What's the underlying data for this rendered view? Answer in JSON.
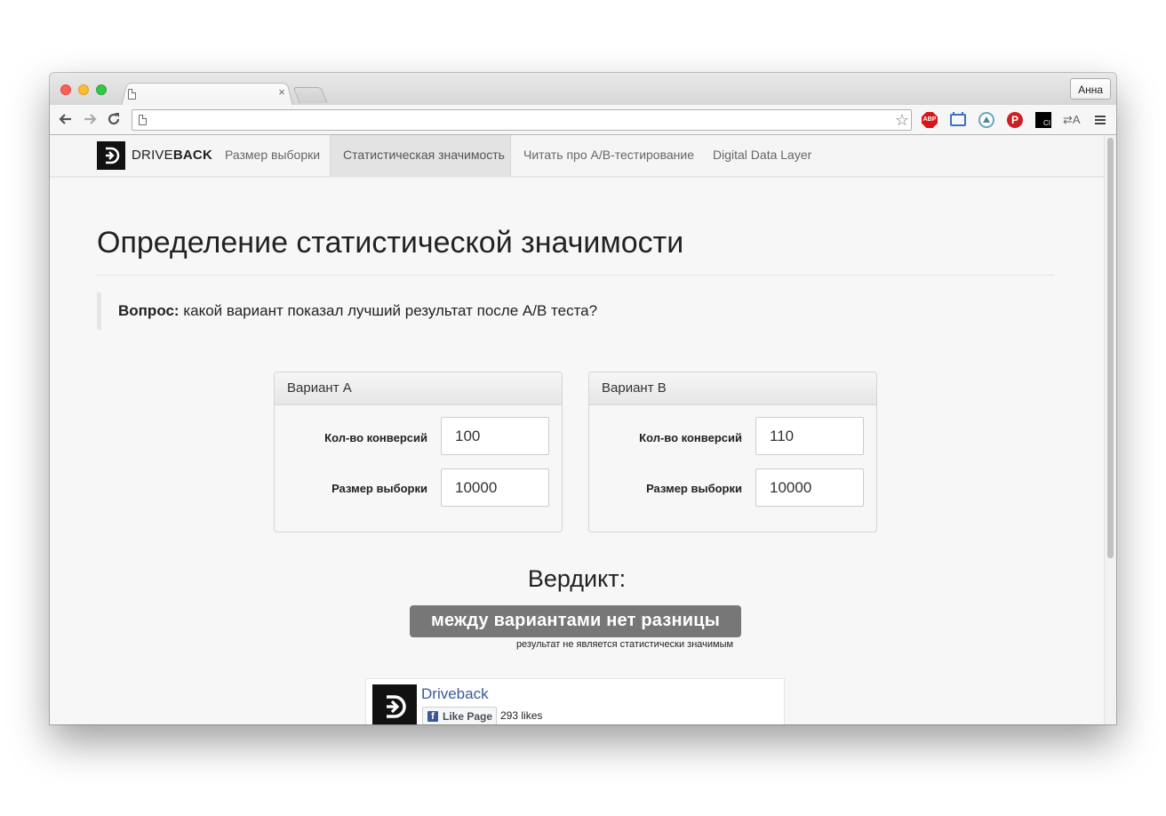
{
  "browser": {
    "tab_close": "×",
    "profile": "Анна",
    "address_value": ""
  },
  "nav": {
    "logo_prefix": "DRIVE",
    "logo_suffix": "BACK",
    "items": [
      {
        "label": "Размер выборки"
      },
      {
        "label": "Статистическая значимость"
      },
      {
        "label": "Читать про A/B-тестирование"
      },
      {
        "label": "Digital Data Layer"
      }
    ]
  },
  "page": {
    "title": "Определение статистической значимости",
    "question_label": "Вопрос:",
    "question_text": " какой вариант показал лучший результат после A/B теста?"
  },
  "variants": [
    {
      "title": "Вариант A",
      "conversions_label": "Кол-во конверсий",
      "conversions": "100",
      "sample_label": "Размер выборки",
      "sample": "10000"
    },
    {
      "title": "Вариант B",
      "conversions_label": "Кол-во конверсий",
      "conversions": "110",
      "sample_label": "Размер выборки",
      "sample": "10000"
    }
  ],
  "verdict": {
    "title": "Вердикт:",
    "badge": "между вариантами нет разницы",
    "note": "результат не является статистически значимым"
  },
  "facebook": {
    "page_name": "Driveback",
    "like_button": "Like Page",
    "likes": "293 likes"
  },
  "extensions": {
    "abp": "ABP",
    "pinterest": "P",
    "ci": "CI",
    "translate": "⇄A"
  },
  "colors": {
    "verdict_badge": "#777777",
    "facebook_blue": "#3b5998"
  }
}
